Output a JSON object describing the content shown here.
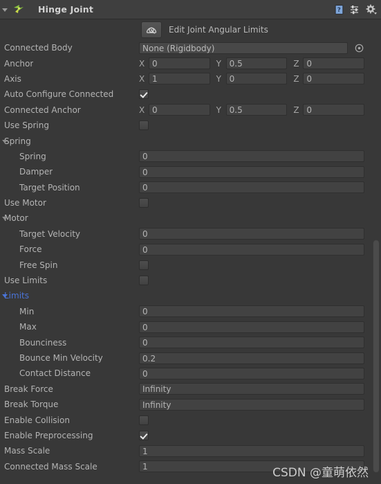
{
  "header": {
    "title": "Hinge Joint",
    "component_icon": "hinge-joint-icon",
    "foldout_state": "expanded",
    "icons": [
      {
        "name": "help-icon",
        "glyph": "?"
      },
      {
        "name": "preset-icon",
        "glyph": "⇅"
      },
      {
        "name": "settings-gear-icon",
        "glyph": "⚙"
      }
    ]
  },
  "edit_tool": {
    "label": "Edit Joint Angular Limits",
    "icon": "joint-angular-limits-icon"
  },
  "properties": {
    "connected_body": {
      "label": "Connected Body",
      "value": "None (Rigidbody)",
      "picker_icon": "object-picker-icon"
    },
    "anchor": {
      "label": "Anchor",
      "axes": [
        "X",
        "Y",
        "Z"
      ],
      "values": [
        "0",
        "0.5",
        "0"
      ]
    },
    "axis": {
      "label": "Axis",
      "axes": [
        "X",
        "Y",
        "Z"
      ],
      "values": [
        "1",
        "0",
        "0"
      ]
    },
    "auto_configure_connected": {
      "label": "Auto Configure Connected",
      "checked": true
    },
    "connected_anchor": {
      "label": "Connected Anchor",
      "axes": [
        "X",
        "Y",
        "Z"
      ],
      "values": [
        "0",
        "0.5",
        "0"
      ]
    },
    "use_spring": {
      "label": "Use Spring",
      "checked": false
    },
    "spring_section": {
      "label": "Spring",
      "expanded": true,
      "highlight": false,
      "fields": [
        {
          "label": "Spring",
          "value": "0"
        },
        {
          "label": "Damper",
          "value": "0"
        },
        {
          "label": "Target Position",
          "value": "0"
        }
      ]
    },
    "use_motor": {
      "label": "Use Motor",
      "checked": false
    },
    "motor_section": {
      "label": "Motor",
      "expanded": true,
      "highlight": false,
      "fields": [
        {
          "label": "Target Velocity",
          "value": "0"
        },
        {
          "label": "Force",
          "value": "0"
        }
      ],
      "free_spin": {
        "label": "Free Spin",
        "checked": false
      }
    },
    "use_limits": {
      "label": "Use Limits",
      "checked": false
    },
    "limits_section": {
      "label": "Limits",
      "expanded": true,
      "highlight": true,
      "highlight_color": "#4a74d8",
      "fields": [
        {
          "label": "Min",
          "value": "0"
        },
        {
          "label": "Max",
          "value": "0"
        },
        {
          "label": "Bounciness",
          "value": "0"
        },
        {
          "label": "Bounce Min Velocity",
          "value": "0.2"
        },
        {
          "label": "Contact Distance",
          "value": "0"
        }
      ]
    },
    "break_force": {
      "label": "Break Force",
      "value": "Infinity"
    },
    "break_torque": {
      "label": "Break Torque",
      "value": "Infinity"
    },
    "enable_collision": {
      "label": "Enable Collision",
      "checked": false
    },
    "enable_preprocessing": {
      "label": "Enable Preprocessing",
      "checked": true
    },
    "mass_scale": {
      "label": "Mass Scale",
      "value": "1"
    },
    "connected_mass_scale": {
      "label": "Connected Mass Scale",
      "value": "1"
    }
  },
  "watermark": {
    "text": "CSDN @童萌依然"
  },
  "theme": {
    "background": "#383838",
    "header_bg": "#3f3f3f",
    "field_bg": "#424242",
    "text": "#b4b4b4",
    "accent_blue": "#4a74d8"
  }
}
